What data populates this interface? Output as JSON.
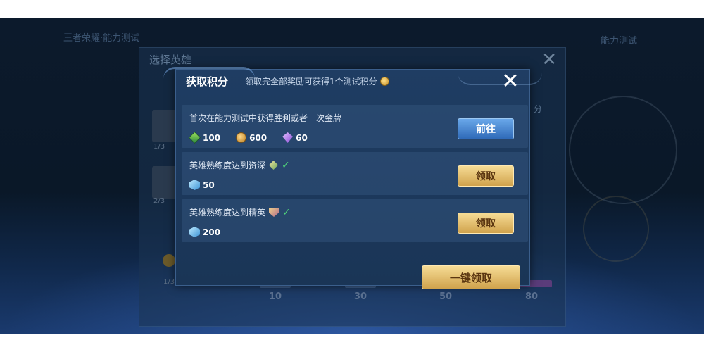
{
  "background": {
    "top_nav": "王者荣耀·能力测试",
    "top_right": "能力测试",
    "panel_title": "选择英雄",
    "close_symbol": "✕",
    "fractions": [
      "1/3",
      "2/3"
    ],
    "bottom_fraction": "1/3",
    "right_fragment": "分",
    "milestones": [
      "10",
      "30",
      "50",
      "80"
    ]
  },
  "dialog": {
    "title": "获取积分",
    "subtitle": "领取完全部奖励可获得1个测试积分",
    "close_symbol": "✕",
    "tasks": [
      {
        "text": "首次在能力测试中获得胜利或者一次金牌",
        "rewards": [
          {
            "icon": "green-crystal-icon",
            "amount": "100"
          },
          {
            "icon": "gold-coin-icon",
            "amount": "600"
          },
          {
            "icon": "purple-gem-icon",
            "amount": "60"
          }
        ],
        "completed": false,
        "button": "前往"
      },
      {
        "text": "英雄熟练度达到资深",
        "badge_icon": "proficiency-badge-icon",
        "check": "✓",
        "rewards": [
          {
            "icon": "blue-crystal-icon",
            "amount": "50"
          }
        ],
        "completed": true,
        "button": "领取"
      },
      {
        "text": "英雄熟练度达到精英",
        "badge_icon": "elite-badge-icon",
        "check": "✓",
        "rewards": [
          {
            "icon": "blue-crystal-icon",
            "amount": "200"
          }
        ],
        "completed": true,
        "button": "领取"
      }
    ],
    "claim_all": "一键领取"
  },
  "colors": {
    "dialog_bg": "#1f3d63",
    "blue_button": "#2f6ab8",
    "gold_button": "#d0a24c",
    "check": "#4fd37a"
  }
}
